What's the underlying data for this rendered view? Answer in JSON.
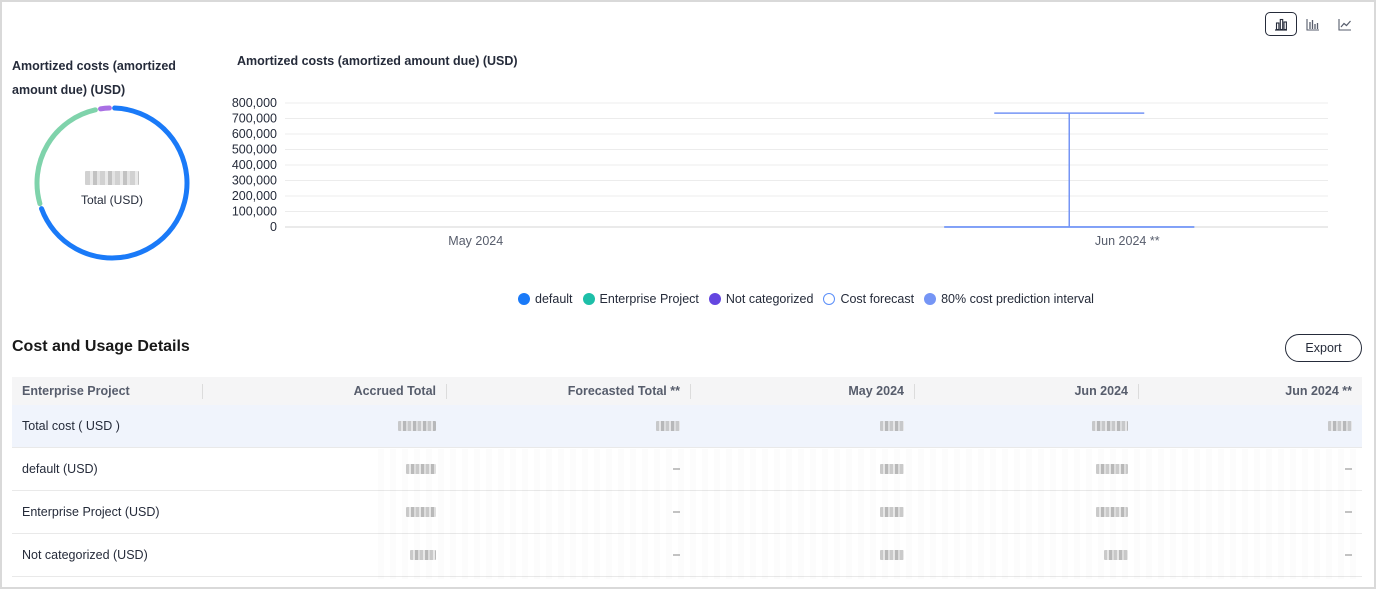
{
  "view_toggle": {
    "options": [
      {
        "icon": "bar-chart-icon",
        "active": true
      },
      {
        "icon": "stacked-bar-icon",
        "active": false
      },
      {
        "icon": "line-chart-icon",
        "active": false
      }
    ]
  },
  "donut": {
    "title": "Amortized costs (amortized amount due) (USD)",
    "center_label": "Total (USD)",
    "segments": [
      {
        "name": "default",
        "color": "#1a7af8",
        "share": 0.7
      },
      {
        "name": "Enterprise Project",
        "color": "#7fd3ab",
        "share": 0.27
      },
      {
        "name": "Not categorized",
        "color": "#a970e4",
        "share": 0.03
      }
    ]
  },
  "chart_data": {
    "type": "bar",
    "title": "Amortized costs (amortized amount due) (USD)",
    "categories": [
      "May 2024",
      "Jun 2024 **"
    ],
    "ylim": [
      0,
      800000
    ],
    "yticks": [
      "800,000",
      "700,000",
      "600,000",
      "500,000",
      "400,000",
      "300,000",
      "200,000",
      "100,000",
      "0"
    ],
    "series": [
      {
        "name": "default",
        "values": [
          0,
          0
        ]
      },
      {
        "name": "Enterprise Project",
        "values": [
          0,
          0
        ]
      },
      {
        "name": "Not categorized",
        "values": [
          0,
          0
        ]
      },
      {
        "name": "Cost forecast",
        "values": [
          null,
          5000
        ]
      }
    ],
    "interval": {
      "name": "80% cost prediction interval",
      "category": "Jun 2024 **",
      "low": 0,
      "high": 735000
    },
    "grid": true,
    "legend_position": "bottom"
  },
  "legend": [
    {
      "label": "default",
      "color": "#1a7af8",
      "style": "filled"
    },
    {
      "label": "Enterprise Project",
      "color": "#1dbfa8",
      "style": "filled"
    },
    {
      "label": "Not categorized",
      "color": "#6446e0",
      "style": "filled"
    },
    {
      "label": "Cost forecast",
      "color": "#5b8ff9",
      "style": "hollow"
    },
    {
      "label": "80% cost prediction interval",
      "color": "#7595f5",
      "style": "filled"
    }
  ],
  "details": {
    "title": "Cost and Usage Details",
    "export_label": "Export",
    "columns": [
      "Enterprise Project",
      "Accrued Total",
      "Forecasted Total **",
      "May 2024",
      "Jun 2024",
      "Jun 2024 **"
    ],
    "rows": [
      {
        "label": "Total cost ( USD )"
      },
      {
        "label": "default (USD)"
      },
      {
        "label": "Enterprise Project (USD)"
      },
      {
        "label": "Not categorized (USD)"
      }
    ]
  }
}
